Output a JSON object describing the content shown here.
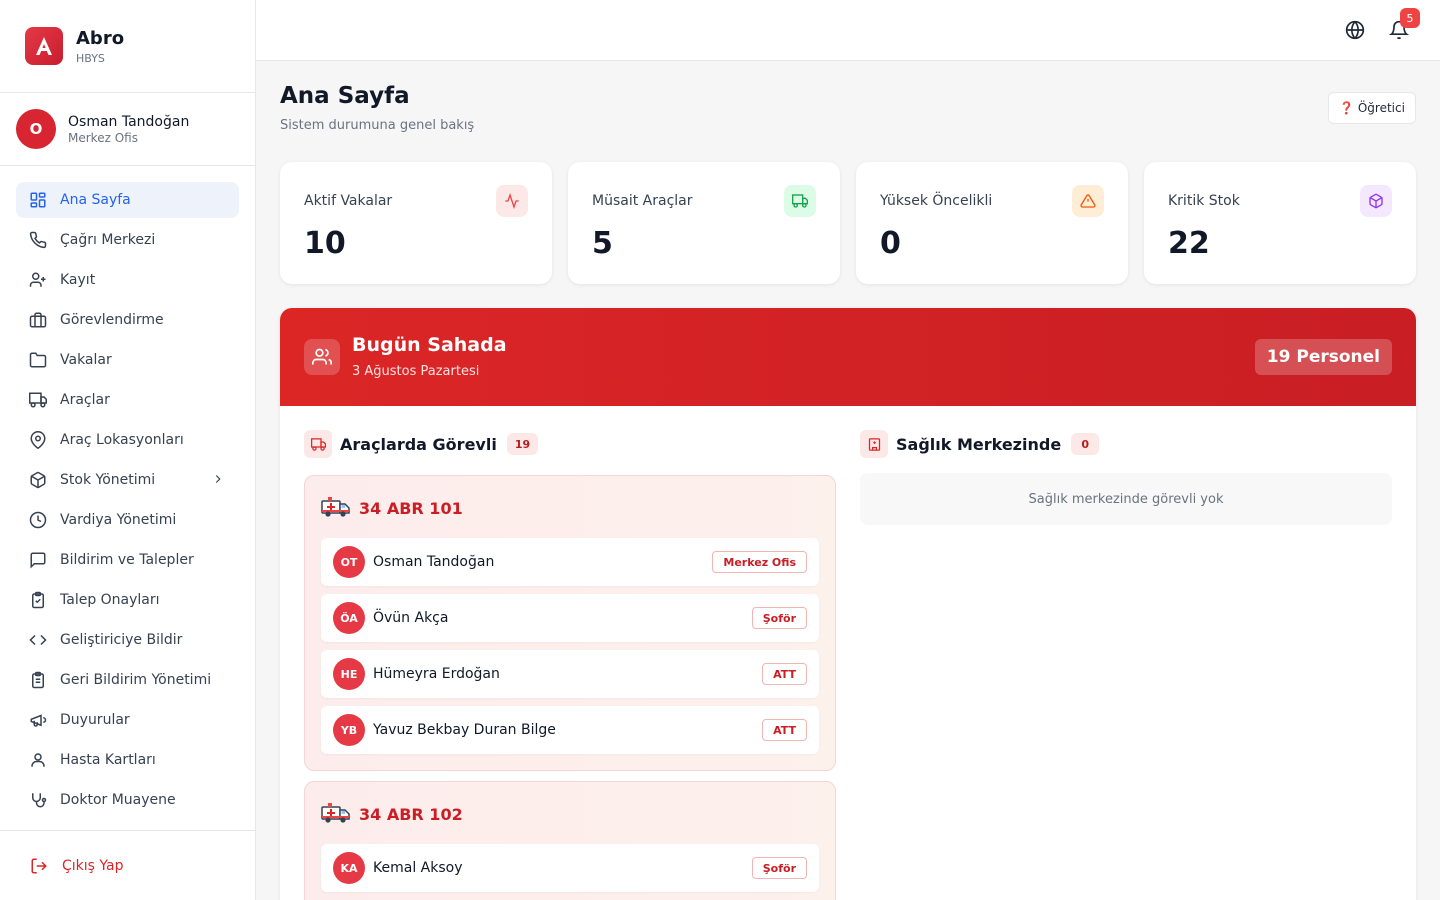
{
  "brand": {
    "name": "Abro",
    "subtitle": "HBYS"
  },
  "user": {
    "initial": "O",
    "name": "Osman Tandoğan",
    "role": "Merkez Ofis"
  },
  "sidebar": {
    "items": [
      {
        "label": "Ana Sayfa",
        "icon": "dashboard-icon",
        "active": true
      },
      {
        "label": "Çağrı Merkezi",
        "icon": "phone-icon"
      },
      {
        "label": "Kayıt",
        "icon": "user-plus-icon"
      },
      {
        "label": "Görevlendirme",
        "icon": "briefcase-icon"
      },
      {
        "label": "Vakalar",
        "icon": "folder-icon"
      },
      {
        "label": "Araçlar",
        "icon": "truck-icon"
      },
      {
        "label": "Araç Lokasyonları",
        "icon": "map-pin-icon"
      },
      {
        "label": "Stok Yönetimi",
        "icon": "package-icon"
      },
      {
        "label": "Vardiya Yönetimi",
        "icon": "clock-icon"
      },
      {
        "label": "Bildirim ve Talepler",
        "icon": "message-icon"
      },
      {
        "label": "Talep Onayları",
        "icon": "clipboard-check-icon"
      },
      {
        "label": "Geliştiriciye Bildir",
        "icon": "code-icon"
      },
      {
        "label": "Geri Bildirim Yönetimi",
        "icon": "clipboard-list-icon"
      },
      {
        "label": "Duyurular",
        "icon": "megaphone-icon"
      },
      {
        "label": "Hasta Kartları",
        "icon": "user-icon"
      },
      {
        "label": "Doktor Muayene",
        "icon": "stethoscope-icon"
      }
    ],
    "logout_label": "Çıkış Yap"
  },
  "topbar": {
    "notification_count": "5"
  },
  "page": {
    "title": "Ana Sayfa",
    "subtitle": "Sistem durumuna genel bakış",
    "tutorial_label": "❓ Öğretici"
  },
  "stats": [
    {
      "label": "Aktif Vakalar",
      "value": "10",
      "icon": "activity-icon",
      "color": "#ef4444",
      "bg": "#fde8e8"
    },
    {
      "label": "Müsait Araçlar",
      "value": "5",
      "icon": "truck-icon",
      "color": "#16a34a",
      "bg": "#dcfce7"
    },
    {
      "label": "Yüksek Öncelikli",
      "value": "0",
      "icon": "warning-icon",
      "color": "#ea580c",
      "bg": "#ffedd5"
    },
    {
      "label": "Kritik Stok",
      "value": "22",
      "icon": "package-icon",
      "color": "#9333ea",
      "bg": "#f3e8ff"
    }
  ],
  "field": {
    "title": "Bugün Sahada",
    "date": "3 Ağustos Pazartesi",
    "count_label": "19 Personel",
    "vehicles_section": {
      "title": "Araçlarda Görevli",
      "count": "19"
    },
    "health_section": {
      "title": "Sağlık Merkezinde",
      "count": "0",
      "empty_text": "Sağlık merkezinde görevli yok"
    },
    "vehicles": [
      {
        "plate": "34 ABR 101",
        "crew": [
          {
            "initials": "OT",
            "name": "Osman Tandoğan",
            "role": "Merkez Ofis"
          },
          {
            "initials": "ÖA",
            "name": "Övün Akça",
            "role": "Şoför"
          },
          {
            "initials": "HE",
            "name": "Hümeyra Erdoğan",
            "role": "ATT"
          },
          {
            "initials": "YB",
            "name": "Yavuz Bekbay Duran Bilge",
            "role": "ATT"
          }
        ]
      },
      {
        "plate": "34 ABR 102",
        "crew": [
          {
            "initials": "KA",
            "name": "Kemal Aksoy",
            "role": "Şoför"
          }
        ]
      }
    ]
  },
  "colors": {
    "accent": "#dc2626",
    "active_nav": "#2563eb"
  }
}
